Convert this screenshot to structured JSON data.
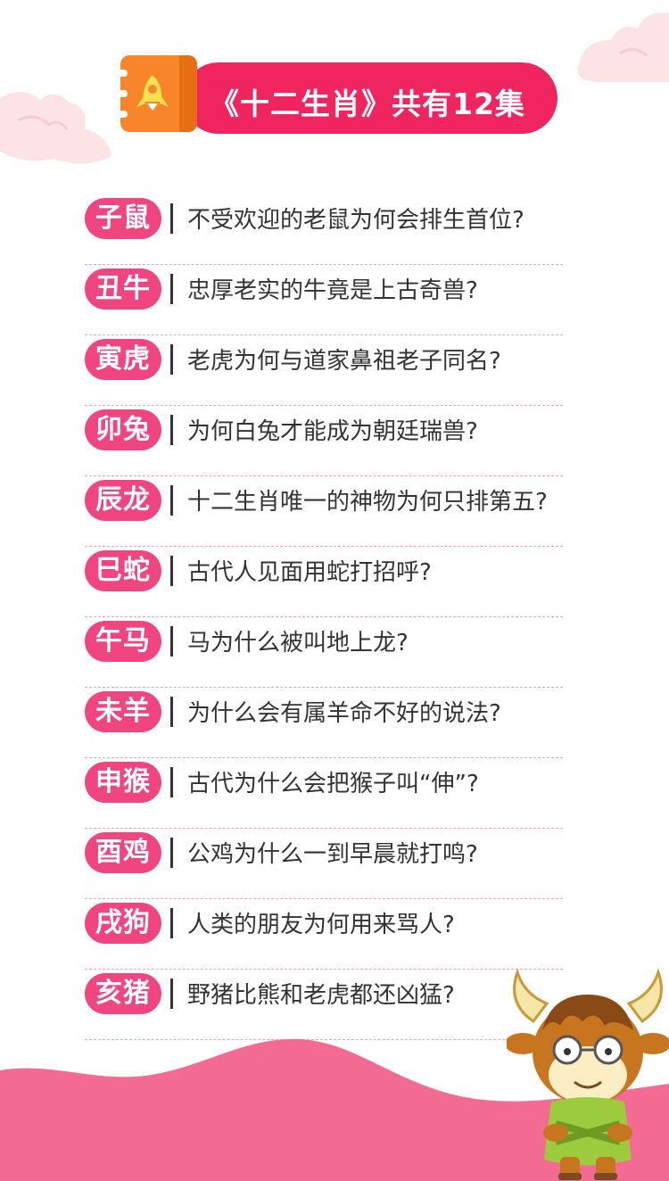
{
  "header": {
    "title": "《十二生肖》共有12集",
    "icon": "book-icon",
    "accent_color": "#f0245f"
  },
  "episodes": [
    {
      "badge": "子鼠",
      "question": "不受欢迎的老鼠为何会排生首位?"
    },
    {
      "badge": "丑牛",
      "question": "忠厚老实的牛竟是上古奇兽?"
    },
    {
      "badge": "寅虎",
      "question": "老虎为何与道家鼻祖老子同名?"
    },
    {
      "badge": "卯兔",
      "question": "为何白兔才能成为朝廷瑞兽?"
    },
    {
      "badge": "辰龙",
      "question": "十二生肖唯一的神物为何只排第五?"
    },
    {
      "badge": "巳蛇",
      "question": "古代人见面用蛇打招呼?"
    },
    {
      "badge": "午马",
      "question": "马为什么被叫地上龙?"
    },
    {
      "badge": "未羊",
      "question": "为什么会有属羊命不好的说法?"
    },
    {
      "badge": "申猴",
      "question": "古代为什么会把猴子叫“伸”?"
    },
    {
      "badge": "酉鸡",
      "question": "公鸡为什么一到早晨就打鸣?"
    },
    {
      "badge": "戌狗",
      "question": "人类的朋友为何用来骂人?"
    },
    {
      "badge": "亥猪",
      "question": "野猪比熊和老虎都还凶猛?"
    }
  ],
  "colors": {
    "badge": "#f0457f",
    "text": "#333333",
    "wave": "#f36a93",
    "divider_line": "#e9a3b9"
  },
  "decorations": [
    "cloud-left",
    "cloud-right",
    "pink-wave",
    "ox-mascot-illustration"
  ]
}
